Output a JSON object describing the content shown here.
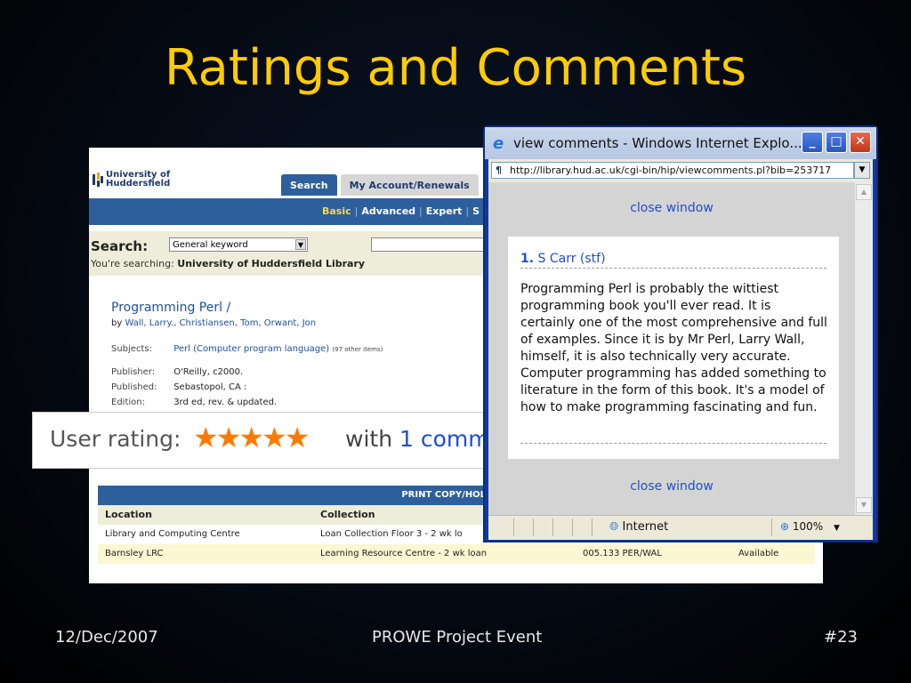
{
  "slide": {
    "title": "Ratings and Comments",
    "footer_date": "12/Dec/2007",
    "footer_event": "PROWE Project Event",
    "footer_page": "#23"
  },
  "catalog": {
    "logo_line1": "University of",
    "logo_line2": "Huddersfield",
    "tabs": [
      "Search",
      "My Account/Renewals"
    ],
    "subnav": [
      "Basic",
      "Advanced",
      "Expert",
      "S"
    ],
    "search_label": "Search:",
    "search_type": "General keyword",
    "searching_prefix": "You're searching:",
    "searching_target": "University of Huddersfield Library",
    "record": {
      "title": "Programming Perl /",
      "by_prefix": "by",
      "authors": "Wall, Larry., Christiansen, Tom, Orwant, Jon",
      "subjects_key": "Subjects:",
      "subjects_value": "Perl (Computer program language)",
      "subjects_note": "(97 other items)",
      "publisher_key": "Publisher:",
      "publisher_value": "O'Reilly, c2000.",
      "published_key": "Published:",
      "published_value": "Sebastopol, CA :",
      "edition_key": "Edition:",
      "edition_value": "3rd ed, rev. & updated."
    },
    "holdings": {
      "heading": "PRINT COPY/HOLDING",
      "columns": [
        "Location",
        "Collection"
      ],
      "rows": [
        {
          "location": "Library and Computing Centre",
          "collection": "Loan Collection Floor 3 - 2 wk lo",
          "call_no": "",
          "status": ""
        },
        {
          "location": "Barnsley LRC",
          "collection": "Learning Resource Centre - 2 wk loan",
          "call_no": "005.133 PER/WAL",
          "status": "Available"
        }
      ]
    }
  },
  "rating": {
    "label": "User rating:",
    "stars": 5,
    "with_text": "with",
    "count": "1",
    "link_partial": "comm"
  },
  "popup": {
    "title": "view comments - Windows Internet Explo...",
    "url": "http://library.hud.ac.uk/cgi-bin/hip/viewcomments.pl?bib=253717",
    "close_link": "close window",
    "comment_number": "1.",
    "comment_author": "S Carr (stf)",
    "comment_text": "Programming Perl is probably the wittiest programming book you'll ever read. It is certainly one of the most comprehensive and full of examples. Since it is by Mr Perl, Larry Wall, himself, it is also technically very accurate. Computer programming has added something to literature in the form of this book. It's a model of how to make programming fascinating and fun.",
    "status_zone": "Internet",
    "status_zoom": "100%"
  },
  "colors": {
    "title": "#ffcc00",
    "catalog_blue": "#2d5f9c",
    "star_orange": "#ff7a00",
    "link_blue": "#1f4fcc"
  }
}
